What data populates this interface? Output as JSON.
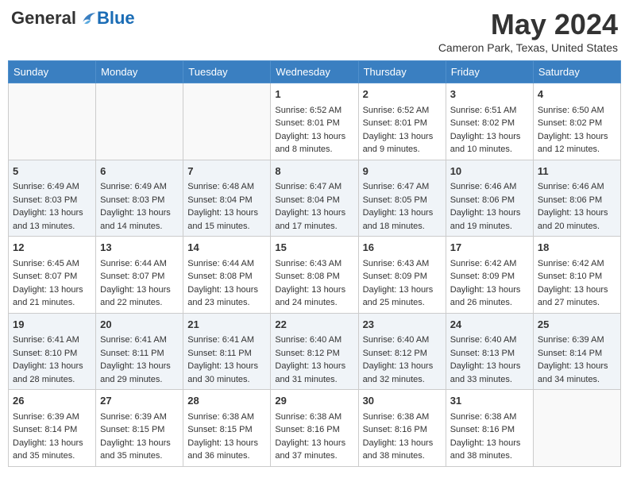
{
  "header": {
    "logo_general": "General",
    "logo_blue": "Blue",
    "month_title": "May 2024",
    "location": "Cameron Park, Texas, United States"
  },
  "days_of_week": [
    "Sunday",
    "Monday",
    "Tuesday",
    "Wednesday",
    "Thursday",
    "Friday",
    "Saturday"
  ],
  "weeks": [
    [
      {
        "day": "",
        "sunrise": "",
        "sunset": "",
        "daylight": ""
      },
      {
        "day": "",
        "sunrise": "",
        "sunset": "",
        "daylight": ""
      },
      {
        "day": "",
        "sunrise": "",
        "sunset": "",
        "daylight": ""
      },
      {
        "day": "1",
        "sunrise": "Sunrise: 6:52 AM",
        "sunset": "Sunset: 8:01 PM",
        "daylight": "Daylight: 13 hours and 8 minutes."
      },
      {
        "day": "2",
        "sunrise": "Sunrise: 6:52 AM",
        "sunset": "Sunset: 8:01 PM",
        "daylight": "Daylight: 13 hours and 9 minutes."
      },
      {
        "day": "3",
        "sunrise": "Sunrise: 6:51 AM",
        "sunset": "Sunset: 8:02 PM",
        "daylight": "Daylight: 13 hours and 10 minutes."
      },
      {
        "day": "4",
        "sunrise": "Sunrise: 6:50 AM",
        "sunset": "Sunset: 8:02 PM",
        "daylight": "Daylight: 13 hours and 12 minutes."
      }
    ],
    [
      {
        "day": "5",
        "sunrise": "Sunrise: 6:49 AM",
        "sunset": "Sunset: 8:03 PM",
        "daylight": "Daylight: 13 hours and 13 minutes."
      },
      {
        "day": "6",
        "sunrise": "Sunrise: 6:49 AM",
        "sunset": "Sunset: 8:03 PM",
        "daylight": "Daylight: 13 hours and 14 minutes."
      },
      {
        "day": "7",
        "sunrise": "Sunrise: 6:48 AM",
        "sunset": "Sunset: 8:04 PM",
        "daylight": "Daylight: 13 hours and 15 minutes."
      },
      {
        "day": "8",
        "sunrise": "Sunrise: 6:47 AM",
        "sunset": "Sunset: 8:04 PM",
        "daylight": "Daylight: 13 hours and 17 minutes."
      },
      {
        "day": "9",
        "sunrise": "Sunrise: 6:47 AM",
        "sunset": "Sunset: 8:05 PM",
        "daylight": "Daylight: 13 hours and 18 minutes."
      },
      {
        "day": "10",
        "sunrise": "Sunrise: 6:46 AM",
        "sunset": "Sunset: 8:06 PM",
        "daylight": "Daylight: 13 hours and 19 minutes."
      },
      {
        "day": "11",
        "sunrise": "Sunrise: 6:46 AM",
        "sunset": "Sunset: 8:06 PM",
        "daylight": "Daylight: 13 hours and 20 minutes."
      }
    ],
    [
      {
        "day": "12",
        "sunrise": "Sunrise: 6:45 AM",
        "sunset": "Sunset: 8:07 PM",
        "daylight": "Daylight: 13 hours and 21 minutes."
      },
      {
        "day": "13",
        "sunrise": "Sunrise: 6:44 AM",
        "sunset": "Sunset: 8:07 PM",
        "daylight": "Daylight: 13 hours and 22 minutes."
      },
      {
        "day": "14",
        "sunrise": "Sunrise: 6:44 AM",
        "sunset": "Sunset: 8:08 PM",
        "daylight": "Daylight: 13 hours and 23 minutes."
      },
      {
        "day": "15",
        "sunrise": "Sunrise: 6:43 AM",
        "sunset": "Sunset: 8:08 PM",
        "daylight": "Daylight: 13 hours and 24 minutes."
      },
      {
        "day": "16",
        "sunrise": "Sunrise: 6:43 AM",
        "sunset": "Sunset: 8:09 PM",
        "daylight": "Daylight: 13 hours and 25 minutes."
      },
      {
        "day": "17",
        "sunrise": "Sunrise: 6:42 AM",
        "sunset": "Sunset: 8:09 PM",
        "daylight": "Daylight: 13 hours and 26 minutes."
      },
      {
        "day": "18",
        "sunrise": "Sunrise: 6:42 AM",
        "sunset": "Sunset: 8:10 PM",
        "daylight": "Daylight: 13 hours and 27 minutes."
      }
    ],
    [
      {
        "day": "19",
        "sunrise": "Sunrise: 6:41 AM",
        "sunset": "Sunset: 8:10 PM",
        "daylight": "Daylight: 13 hours and 28 minutes."
      },
      {
        "day": "20",
        "sunrise": "Sunrise: 6:41 AM",
        "sunset": "Sunset: 8:11 PM",
        "daylight": "Daylight: 13 hours and 29 minutes."
      },
      {
        "day": "21",
        "sunrise": "Sunrise: 6:41 AM",
        "sunset": "Sunset: 8:11 PM",
        "daylight": "Daylight: 13 hours and 30 minutes."
      },
      {
        "day": "22",
        "sunrise": "Sunrise: 6:40 AM",
        "sunset": "Sunset: 8:12 PM",
        "daylight": "Daylight: 13 hours and 31 minutes."
      },
      {
        "day": "23",
        "sunrise": "Sunrise: 6:40 AM",
        "sunset": "Sunset: 8:12 PM",
        "daylight": "Daylight: 13 hours and 32 minutes."
      },
      {
        "day": "24",
        "sunrise": "Sunrise: 6:40 AM",
        "sunset": "Sunset: 8:13 PM",
        "daylight": "Daylight: 13 hours and 33 minutes."
      },
      {
        "day": "25",
        "sunrise": "Sunrise: 6:39 AM",
        "sunset": "Sunset: 8:14 PM",
        "daylight": "Daylight: 13 hours and 34 minutes."
      }
    ],
    [
      {
        "day": "26",
        "sunrise": "Sunrise: 6:39 AM",
        "sunset": "Sunset: 8:14 PM",
        "daylight": "Daylight: 13 hours and 35 minutes."
      },
      {
        "day": "27",
        "sunrise": "Sunrise: 6:39 AM",
        "sunset": "Sunset: 8:15 PM",
        "daylight": "Daylight: 13 hours and 35 minutes."
      },
      {
        "day": "28",
        "sunrise": "Sunrise: 6:38 AM",
        "sunset": "Sunset: 8:15 PM",
        "daylight": "Daylight: 13 hours and 36 minutes."
      },
      {
        "day": "29",
        "sunrise": "Sunrise: 6:38 AM",
        "sunset": "Sunset: 8:16 PM",
        "daylight": "Daylight: 13 hours and 37 minutes."
      },
      {
        "day": "30",
        "sunrise": "Sunrise: 6:38 AM",
        "sunset": "Sunset: 8:16 PM",
        "daylight": "Daylight: 13 hours and 38 minutes."
      },
      {
        "day": "31",
        "sunrise": "Sunrise: 6:38 AM",
        "sunset": "Sunset: 8:16 PM",
        "daylight": "Daylight: 13 hours and 38 minutes."
      },
      {
        "day": "",
        "sunrise": "",
        "sunset": "",
        "daylight": ""
      }
    ]
  ]
}
